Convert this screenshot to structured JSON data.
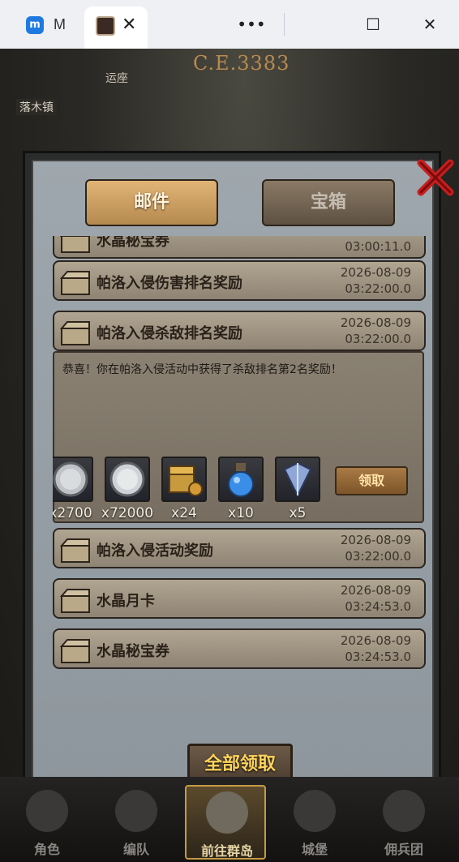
{
  "browser": {
    "tabs": [
      {
        "label": "M",
        "active": false,
        "favicon": "app-logo-icon"
      },
      {
        "label": "",
        "active": true,
        "favicon": "game-icon",
        "close_label": "✕"
      }
    ],
    "controls": {
      "more": "•••",
      "maximize": "☐",
      "close": "✕"
    }
  },
  "game": {
    "era": "C.E.3383",
    "location": "落木镇",
    "top_text": "运座",
    "modal": {
      "tabs": [
        {
          "label": "邮件",
          "active": true
        },
        {
          "label": "宝箱",
          "active": false
        }
      ],
      "mails": [
        {
          "title": "水晶秘宝券",
          "date": "",
          "time": "03:00:11.0"
        },
        {
          "title": "帕洛入侵伤害排名奖励",
          "date": "2026-08-09",
          "time": "03:22:00.0"
        },
        {
          "title": "帕洛入侵杀敌排名奖励",
          "date": "2026-08-09",
          "time": "03:22:00.0",
          "expanded": true
        },
        {
          "title": "帕洛入侵活动奖励",
          "date": "2026-08-09",
          "time": "03:22:00.0"
        },
        {
          "title": "水晶月卡",
          "date": "2026-08-09",
          "time": "03:24:53.0"
        },
        {
          "title": "水晶秘宝券",
          "date": "2026-08-09",
          "time": "03:24:53.0"
        }
      ],
      "expanded_message": "恭喜！你在帕洛入侵活动中获得了杀敌排名第2名奖励！",
      "rewards": [
        {
          "icon": "silver-coin-icon",
          "qty": "x2700"
        },
        {
          "icon": "silver-coin-icon",
          "qty": "x72000"
        },
        {
          "icon": "treasure-chest-icon",
          "qty": "x24"
        },
        {
          "icon": "potion-icon",
          "qty": "x10"
        },
        {
          "icon": "crystal-icon",
          "qty": "x5"
        }
      ],
      "claim_label": "领取",
      "claim_all_label": "全部领取"
    },
    "bottom_nav": [
      {
        "label": "角色",
        "active": false
      },
      {
        "label": "编队",
        "active": false
      },
      {
        "label": "前往群岛",
        "active": true
      },
      {
        "label": "城堡",
        "active": false
      },
      {
        "label": "佣兵团",
        "active": false
      }
    ],
    "colors": {
      "accent": "#ffd45a",
      "panel": "#9ea7ad",
      "tab_active": "#e1b476"
    }
  }
}
